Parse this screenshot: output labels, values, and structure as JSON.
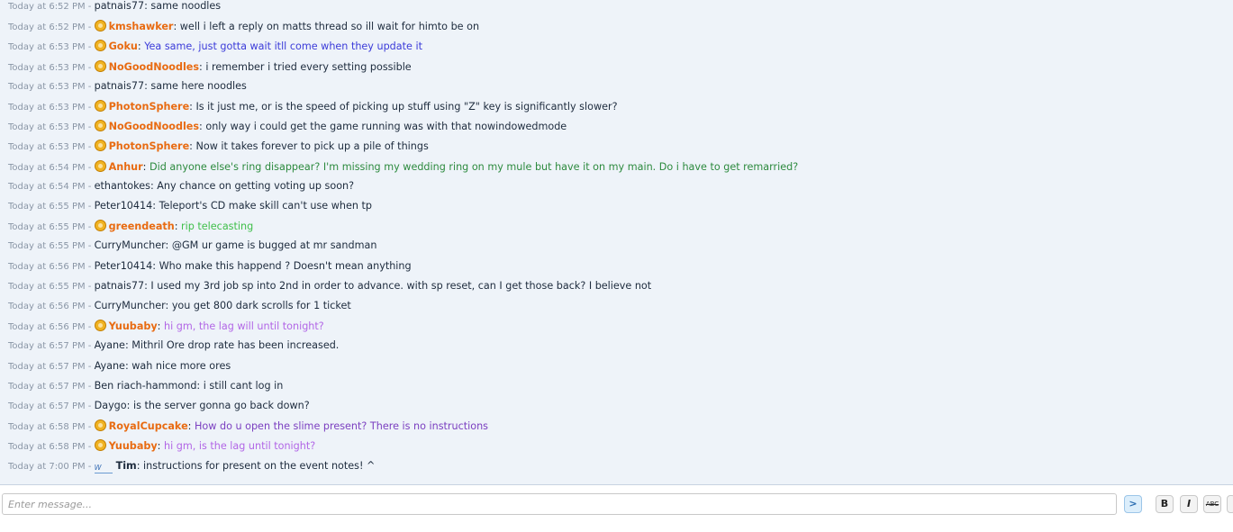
{
  "messages": [
    {
      "time": "Today at 6:52 PM",
      "user": "patnais77",
      "text": "same noodles",
      "staff": false,
      "color": "#1d2b3d"
    },
    {
      "time": "Today at 6:52 PM",
      "user": "kmshawker",
      "text": "well i left a reply on matts thread so ill wait for himto be on",
      "staff": true,
      "color": "#1d2b3d"
    },
    {
      "time": "Today at 6:53 PM",
      "user": "Goku",
      "text": "Yea same, just gotta wait itll come when they update it",
      "staff": true,
      "color": "#3b3bd9"
    },
    {
      "time": "Today at 6:53 PM",
      "user": "NoGoodNoodles",
      "text": "i remember i tried every setting possible",
      "staff": true,
      "color": "#1d2b3d"
    },
    {
      "time": "Today at 6:53 PM",
      "user": "patnais77",
      "text": "same here noodles",
      "staff": false,
      "color": "#1d2b3d"
    },
    {
      "time": "Today at 6:53 PM",
      "user": "PhotonSphere",
      "text": "Is it just me, or is the speed of picking up stuff using \"Z\" key is significantly slower?",
      "staff": true,
      "color": "#1d2b3d"
    },
    {
      "time": "Today at 6:53 PM",
      "user": "NoGoodNoodles",
      "text": "only way i could get the game running was with that nowindowedmode",
      "staff": true,
      "color": "#1d2b3d"
    },
    {
      "time": "Today at 6:53 PM",
      "user": "PhotonSphere",
      "text": "Now it takes forever to pick up a pile of things",
      "staff": true,
      "color": "#1d2b3d"
    },
    {
      "time": "Today at 6:54 PM",
      "user": "Anhur",
      "text": "Did anyone else's ring disappear? I'm missing my wedding ring on my mule but have it on my main. Do i have to get remarried?",
      "staff": true,
      "color": "#2c8a3e"
    },
    {
      "time": "Today at 6:54 PM",
      "user": "ethantokes",
      "text": "Any chance on getting voting up soon?",
      "staff": false,
      "color": "#1d2b3d"
    },
    {
      "time": "Today at 6:55 PM",
      "user": "Peter10414",
      "text": "Teleport's CD make skill can't use when tp",
      "staff": false,
      "color": "#1d2b3d"
    },
    {
      "time": "Today at 6:55 PM",
      "user": "greendeath",
      "text": "rip telecasting",
      "staff": true,
      "color": "#3fbf4a"
    },
    {
      "time": "Today at 6:55 PM",
      "user": "CurryMuncher",
      "text": "@GM ur game is bugged at mr sandman",
      "staff": false,
      "color": "#1d2b3d"
    },
    {
      "time": "Today at 6:56 PM",
      "user": "Peter10414",
      "text": "Who make this happend ? Doesn't mean anything",
      "staff": false,
      "color": "#1d2b3d"
    },
    {
      "time": "Today at 6:55 PM",
      "user": "patnais77",
      "text": "I used my 3rd job sp into 2nd in order to advance. with sp reset, can I get those back? I believe not",
      "staff": false,
      "color": "#1d2b3d"
    },
    {
      "time": "Today at 6:56 PM",
      "user": "CurryMuncher",
      "text": "you get 800 dark scrolls for 1 ticket",
      "staff": false,
      "color": "#1d2b3d"
    },
    {
      "time": "Today at 6:56 PM",
      "user": "Yuubaby",
      "text": "hi gm, the lag will until tonight?",
      "staff": true,
      "color": "#b266e6"
    },
    {
      "time": "Today at 6:57 PM",
      "user": "Ayane",
      "text": "Mithril Ore drop rate has been increased.",
      "staff": false,
      "color": "#1d2b3d"
    },
    {
      "time": "Today at 6:57 PM",
      "user": "Ayane",
      "text": "wah nice more ores",
      "staff": false,
      "color": "#1d2b3d"
    },
    {
      "time": "Today at 6:57 PM",
      "user": "Ben riach-hammond",
      "text": "i still cant log in",
      "staff": false,
      "color": "#1d2b3d"
    },
    {
      "time": "Today at 6:57 PM",
      "user": "Daygo",
      "text": "is the server gonna go back down?",
      "staff": false,
      "color": "#1d2b3d"
    },
    {
      "time": "Today at 6:58 PM",
      "user": "RoyalCupcake",
      "text": "How do u open the slime present? There is no instructions",
      "staff": true,
      "color": "#7b3fc0"
    },
    {
      "time": "Today at 6:58 PM",
      "user": "Yuubaby",
      "text": "hi gm, is the lag until tonight?",
      "staff": true,
      "color": "#b266e6"
    },
    {
      "time": "Today at 7:00 PM",
      "user": "Tim",
      "text": "instructions for present on the event notes! ^",
      "staff": false,
      "tim": true,
      "color": "#1d2b3d"
    }
  ],
  "composer": {
    "placeholder": "Enter message..."
  },
  "toolbar": {
    "send_label": ">",
    "bold_label": "B",
    "italic_label": "I",
    "strike_label": "ABC"
  },
  "tim_icon_text": "W"
}
